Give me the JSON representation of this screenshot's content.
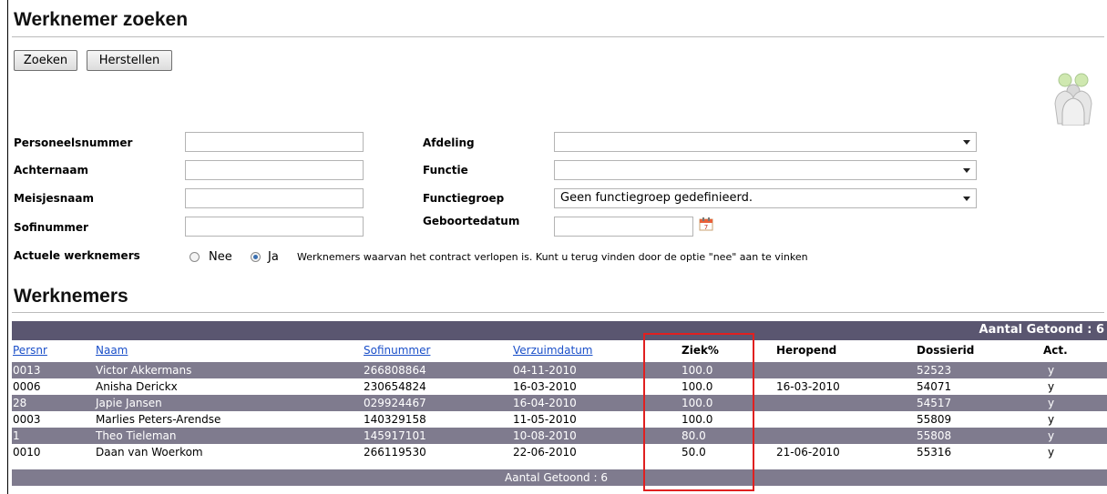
{
  "page": {
    "title": "Werknemer zoeken"
  },
  "toolbar": {
    "search_label": "Zoeken",
    "reset_label": "Herstellen"
  },
  "form": {
    "personeelsnummer": {
      "label": "Personeelsnummer",
      "value": ""
    },
    "achternaam": {
      "label": "Achternaam",
      "value": ""
    },
    "meisjesnaam": {
      "label": "Meisjesnaam",
      "value": ""
    },
    "sofinummer": {
      "label": "Sofinummer",
      "value": ""
    },
    "afdeling": {
      "label": "Afdeling",
      "value": ""
    },
    "functie": {
      "label": "Functie",
      "value": ""
    },
    "functiegroep": {
      "label": "Functiegroep",
      "value": "Geen functiegroep gedefinieerd."
    },
    "geboortedatum": {
      "label": "Geboortedatum",
      "value": ""
    },
    "actueel": {
      "label": "Actuele werknemers",
      "option_nee": "Nee",
      "option_ja": "Ja",
      "selected": "Ja",
      "note": "Werknemers waarvan het contract verlopen is. Kunt u terug vinden door de optie \"nee\" aan te vinken"
    }
  },
  "results": {
    "title": "Werknemers",
    "count_header": "Aantal Getoond : 6",
    "count_footer": "Aantal Getoond : 6",
    "columns": [
      "Persnr",
      "Naam",
      "Sofinummer",
      "Verzuimdatum",
      "Ziek%",
      "Heropend",
      "Dossierid",
      "Act."
    ],
    "rows": [
      {
        "persnr": "0013",
        "naam": "Victor Akkermans",
        "sofinummer": "266808864",
        "verzuimdatum": "04-11-2010",
        "ziek": "100.0",
        "heropend": "",
        "dossierid": "52523",
        "act": "y"
      },
      {
        "persnr": "0006",
        "naam": "Anisha Derickx",
        "sofinummer": "230654824",
        "verzuimdatum": "16-03-2010",
        "ziek": "100.0",
        "heropend": "16-03-2010",
        "dossierid": "54071",
        "act": "y"
      },
      {
        "persnr": "28",
        "naam": "Japie Jansen",
        "sofinummer": "029924467",
        "verzuimdatum": "16-04-2010",
        "ziek": "100.0",
        "heropend": "",
        "dossierid": "54517",
        "act": "y"
      },
      {
        "persnr": "0003",
        "naam": "Marlies Peters-Arendse",
        "sofinummer": "140329158",
        "verzuimdatum": "11-05-2010",
        "ziek": "100.0",
        "heropend": "",
        "dossierid": "55809",
        "act": "y"
      },
      {
        "persnr": "1",
        "naam": "Theo Tieleman",
        "sofinummer": "145917101",
        "verzuimdatum": "10-08-2010",
        "ziek": "80.0",
        "heropend": "",
        "dossierid": "55808",
        "act": "y"
      },
      {
        "persnr": "0010",
        "naam": "Daan van Woerkom",
        "sofinummer": "266119530",
        "verzuimdatum": "22-06-2010",
        "ziek": "50.0",
        "heropend": "21-06-2010",
        "dossierid": "55316",
        "act": "y"
      }
    ]
  },
  "icons": {
    "people": "people-group-icon",
    "calendar": "calendar-icon"
  },
  "colors": {
    "table_header": "#5a5670",
    "row_dark": "#7f7b8e",
    "link": "#1a4fc9",
    "highlight": "#e02020"
  }
}
